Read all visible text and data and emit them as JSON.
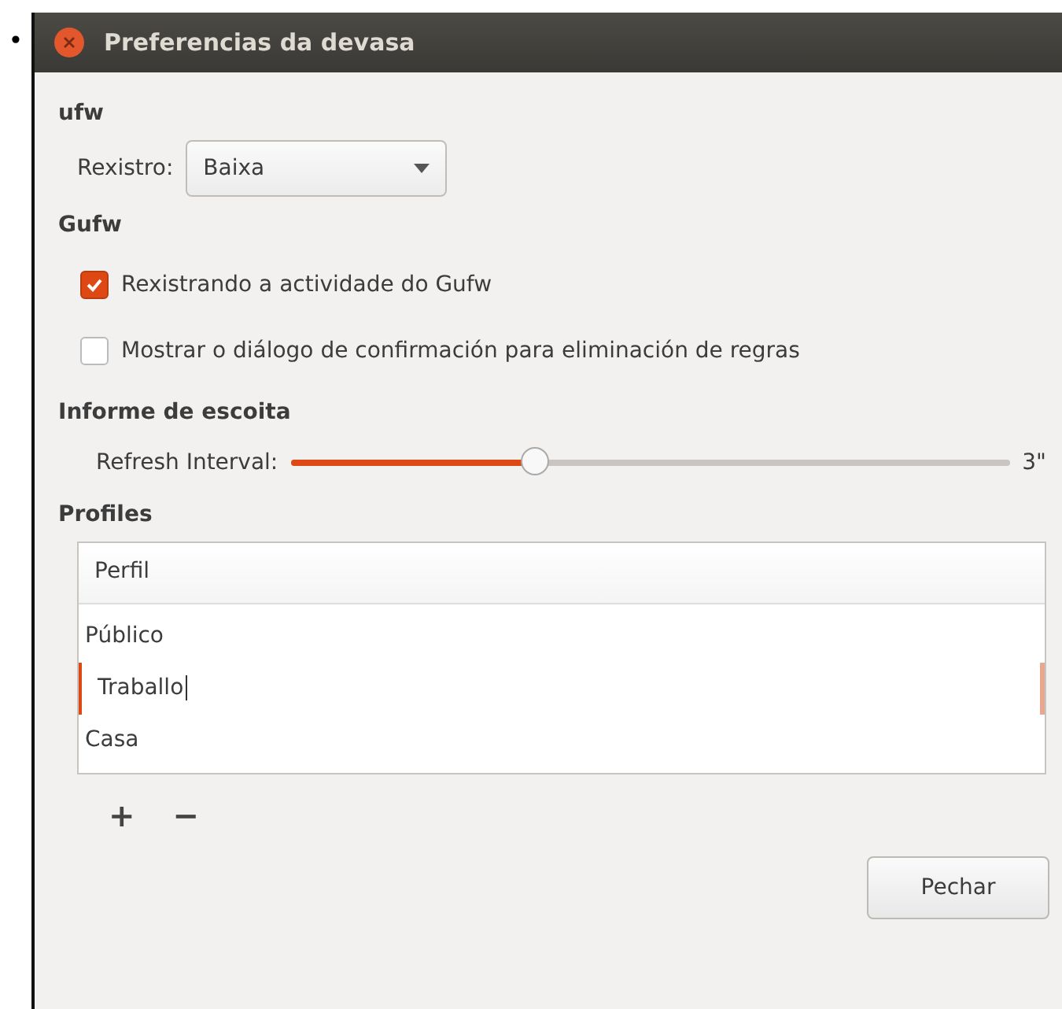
{
  "bullet": "•",
  "window": {
    "title": "Preferencias da devasa"
  },
  "sections": [
    {
      "kind": "combo",
      "heading": "ufw",
      "label": "Rexistro:",
      "value": "Baixa"
    },
    {
      "kind": "checks",
      "heading": "Gufw",
      "items": [
        {
          "label": "Rexistrando a actividade do Gufw",
          "checked": true
        },
        {
          "label": "Mostrar o diálogo de confirmación para eliminación de regras",
          "checked": false
        }
      ]
    },
    {
      "kind": "slider",
      "heading": "Informe de escoita",
      "label": "Refresh Interval:",
      "level": 0.34,
      "reading": "3\""
    },
    {
      "kind": "list",
      "heading": "Profiles",
      "column": "Perfil",
      "rows": [
        {
          "name": "Público",
          "editing": false
        },
        {
          "name": "Traballo",
          "editing": true
        },
        {
          "name": "Casa",
          "editing": false
        }
      ],
      "add": "+",
      "remove": "−"
    }
  ],
  "buttons": [
    "Pechar"
  ]
}
